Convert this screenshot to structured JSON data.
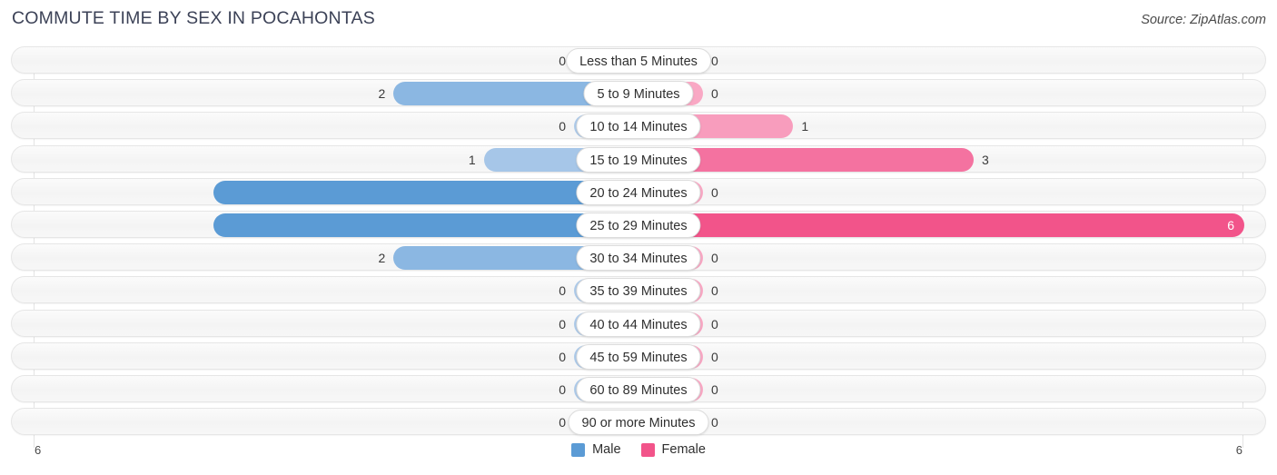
{
  "header": {
    "title": "COMMUTE TIME BY SEX IN POCAHONTAS",
    "source": "Source: ZipAtlas.com"
  },
  "axis": {
    "left_label": "6",
    "right_label": "6"
  },
  "legend": {
    "items": [
      {
        "label": "Male",
        "color": "#5b9bd5"
      },
      {
        "label": "Female",
        "color": "#f2548a"
      }
    ]
  },
  "chart_data": {
    "type": "bar",
    "orientation": "horizontal-diverging",
    "title": "COMMUTE TIME BY SEX IN POCAHONTAS",
    "subtitle": "Source: ZipAtlas.com",
    "xlabel": "",
    "ylabel": "",
    "xlim": [
      0,
      6
    ],
    "axis_max": 6,
    "grid": true,
    "legend_position": "bottom-center",
    "categories": [
      "Less than 5 Minutes",
      "5 to 9 Minutes",
      "10 to 14 Minutes",
      "15 to 19 Minutes",
      "20 to 24 Minutes",
      "25 to 29 Minutes",
      "30 to 34 Minutes",
      "35 to 39 Minutes",
      "40 to 44 Minutes",
      "45 to 59 Minutes",
      "60 to 89 Minutes",
      "90 or more Minutes"
    ],
    "series": [
      {
        "name": "Male",
        "color": "#5b9bd5",
        "values": [
          0,
          2,
          0,
          1,
          4,
          4,
          2,
          0,
          0,
          0,
          0,
          0
        ]
      },
      {
        "name": "Female",
        "color": "#f2548a",
        "values": [
          0,
          0,
          1,
          3,
          0,
          6,
          0,
          0,
          0,
          0,
          0,
          0
        ]
      }
    ]
  },
  "rows": [
    {
      "label": "Less than 5 Minutes",
      "male": "0",
      "female": "0",
      "male_value": 0,
      "female_value": 0
    },
    {
      "label": "5 to 9 Minutes",
      "male": "2",
      "female": "0",
      "male_value": 2,
      "female_value": 0
    },
    {
      "label": "10 to 14 Minutes",
      "male": "0",
      "female": "1",
      "male_value": 0,
      "female_value": 1
    },
    {
      "label": "15 to 19 Minutes",
      "male": "1",
      "female": "3",
      "male_value": 1,
      "female_value": 3
    },
    {
      "label": "20 to 24 Minutes",
      "male": "4",
      "female": "0",
      "male_value": 4,
      "female_value": 0
    },
    {
      "label": "25 to 29 Minutes",
      "male": "4",
      "female": "6",
      "male_value": 4,
      "female_value": 6
    },
    {
      "label": "30 to 34 Minutes",
      "male": "2",
      "female": "0",
      "male_value": 2,
      "female_value": 0
    },
    {
      "label": "35 to 39 Minutes",
      "male": "0",
      "female": "0",
      "male_value": 0,
      "female_value": 0
    },
    {
      "label": "40 to 44 Minutes",
      "male": "0",
      "female": "0",
      "male_value": 0,
      "female_value": 0
    },
    {
      "label": "45 to 59 Minutes",
      "male": "0",
      "female": "0",
      "male_value": 0,
      "female_value": 0
    },
    {
      "label": "60 to 89 Minutes",
      "male": "0",
      "female": "0",
      "male_value": 0,
      "female_value": 0
    },
    {
      "label": "90 or more Minutes",
      "male": "0",
      "female": "0",
      "male_value": 0,
      "female_value": 0
    }
  ],
  "style": {
    "male_palette": [
      "#aecbea",
      "#a6c6e8",
      "#8bb7e2",
      "#7db0de",
      "#5b9bd5",
      "#5b9bd5",
      "#5b9bd5"
    ],
    "female_palette": [
      "#f9a8c4",
      "#f89dbd",
      "#f78cb2",
      "#f472a0",
      "#f2548a",
      "#f2548a",
      "#f2548a"
    ]
  }
}
